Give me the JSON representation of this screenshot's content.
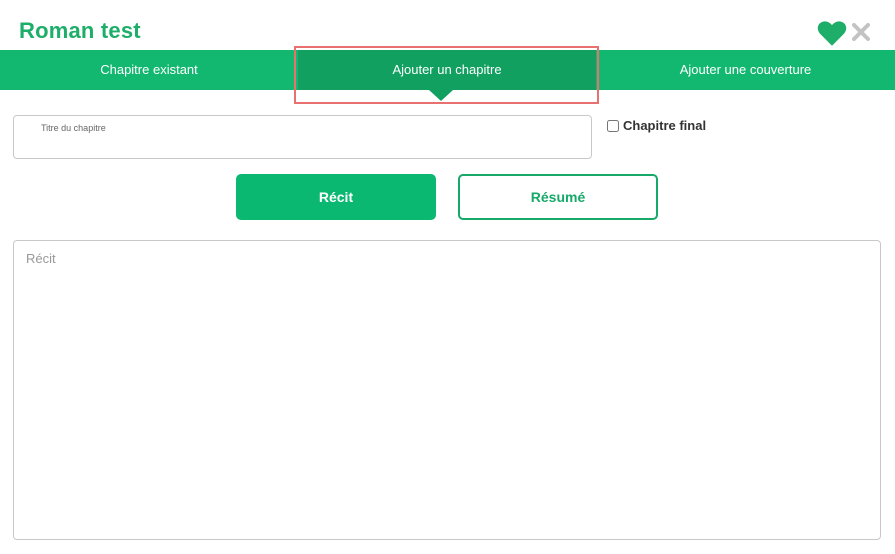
{
  "header": {
    "title": "Roman test",
    "favorite_icon": "heart-icon",
    "close_icon": "close-icon",
    "accent_color": "#1fae6a"
  },
  "tabs": [
    {
      "label": "Chapitre existant",
      "active": false
    },
    {
      "label": "Ajouter un chapitre",
      "active": true
    },
    {
      "label": "Ajouter une couverture",
      "active": false
    }
  ],
  "form": {
    "chapter_title_label": "Titre du chapitre",
    "chapter_title_value": "",
    "final_chapter_label": "Chapitre final",
    "final_chapter_checked": false,
    "recit_button_label": "Récit",
    "resume_button_label": "Résumé",
    "story_placeholder": "Récit"
  }
}
